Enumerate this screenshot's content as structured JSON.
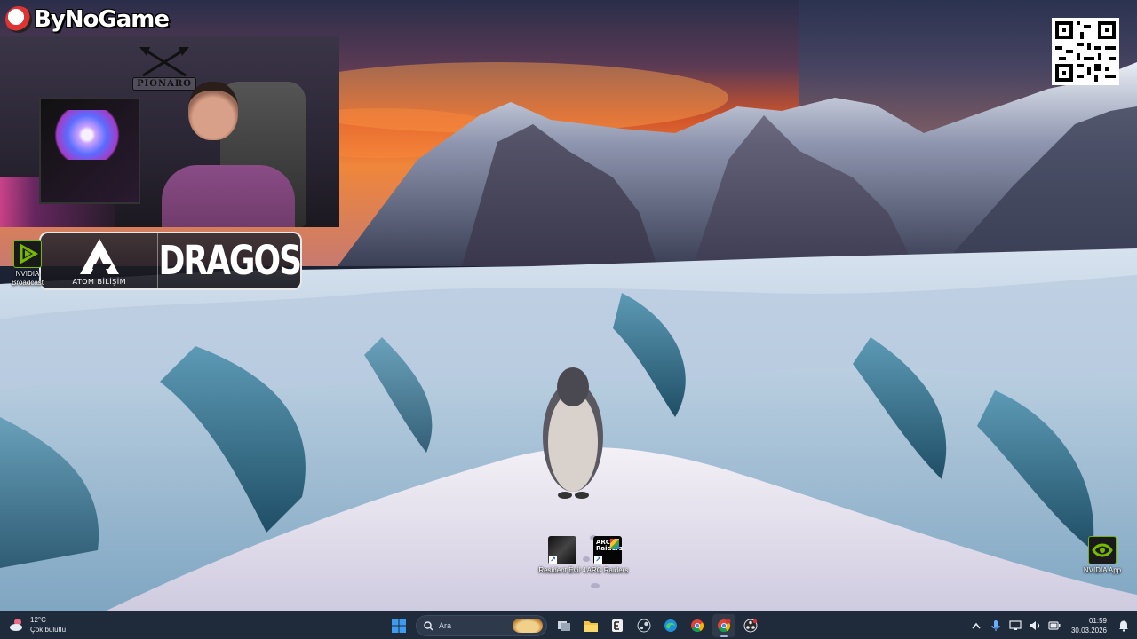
{
  "overlay": {
    "brand_name": "ByNoGame",
    "webcam_crest": "PIONARO",
    "sponsors": {
      "atom_label": "ATOM BİLİŞİM",
      "dragos_label": "DRAGOS"
    }
  },
  "desktop": {
    "icons": [
      {
        "id": "nvidia-broadcast",
        "label": "NVIDIA Broadcast"
      },
      {
        "id": "resident-evil-4",
        "label": "Resident Evil 4"
      },
      {
        "id": "arc-raiders",
        "label": "ARC Raiders",
        "badge": "ARC Raiders"
      },
      {
        "id": "nvidia-app",
        "label": "NVIDIA App"
      }
    ]
  },
  "taskbar": {
    "weather": {
      "temp": "12°C",
      "condition": "Çok bulutlu"
    },
    "search_placeholder": "Ara",
    "pinned_icons": [
      "windows-start-icon",
      "search-icon",
      "task-view-icon",
      "file-explorer-icon",
      "epic-games-icon",
      "steam-icon",
      "edge-icon",
      "chrome-icon",
      "chrome-profile-icon",
      "obs-icon"
    ],
    "tray": {
      "time": "01:59",
      "date": "30.03.2026"
    }
  },
  "colors": {
    "taskbar_bg": "#1f2a3a",
    "nvidia_green": "#76b900",
    "sky_orange": "#e8602a",
    "accent_blue": "#3d8bd8"
  }
}
